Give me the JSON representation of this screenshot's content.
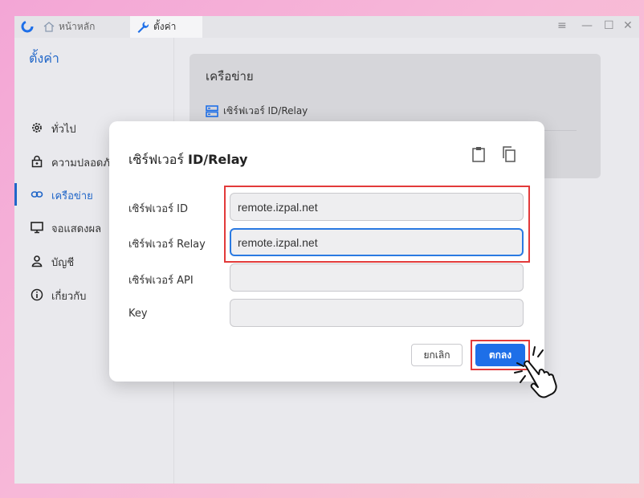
{
  "titlebar": {
    "tabs": [
      {
        "label": "หน้าหลัก",
        "icon": "home-icon"
      },
      {
        "label": "ตั้งค่า",
        "icon": "wrench-icon"
      }
    ],
    "controls": [
      "menu",
      "minimize",
      "maximize",
      "close"
    ]
  },
  "sidebar": {
    "title": "ตั้งค่า",
    "items": [
      {
        "label": "ทั่วไป",
        "icon": "gear-icon"
      },
      {
        "label": "ความปลอดภั",
        "icon": "lock-icon"
      },
      {
        "label": "เครือข่าย",
        "icon": "link-icon",
        "active": true
      },
      {
        "label": "จอแสดงผล",
        "icon": "monitor-icon"
      },
      {
        "label": "บัญชี",
        "icon": "user-icon"
      },
      {
        "label": "เกี่ยวกับ",
        "icon": "info-icon"
      }
    ]
  },
  "main": {
    "card_title": "เครือข่าย",
    "row_label": "เซิร์ฟเวอร์ ID/Relay"
  },
  "dialog": {
    "title_prefix": "เซิร์ฟเวอร์ ",
    "title_suffix": "ID/Relay",
    "fields": [
      {
        "label": "เซิร์ฟเวอร์ ID",
        "value": "remote.izpal.net"
      },
      {
        "label": "เซิร์ฟเวอร์ Relay",
        "value": "remote.izpal.net"
      },
      {
        "label": "เซิร์ฟเวอร์ API",
        "value": ""
      },
      {
        "label": "Key",
        "value": ""
      }
    ],
    "cancel_label": "ยกเลิก",
    "ok_label": "ตกลง"
  },
  "colors": {
    "accent": "#2066c8",
    "button_primary": "#1e6fe8",
    "highlight_box": "#e23a3a"
  }
}
